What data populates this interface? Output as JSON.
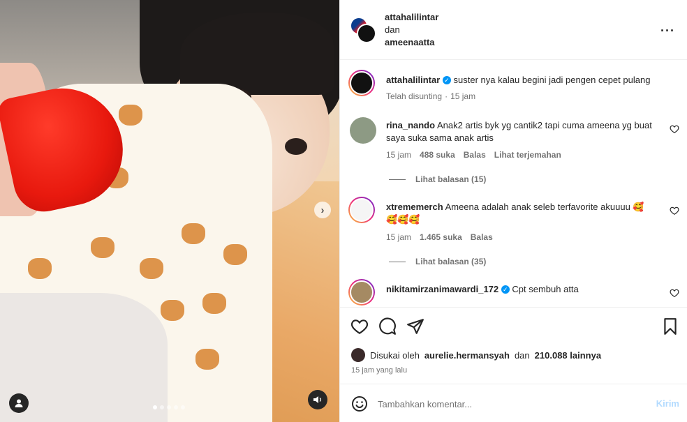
{
  "post": {
    "carousel_dots": 5,
    "active_dot": 0
  },
  "header": {
    "author": "attahalilintar",
    "joiner": "dan",
    "coauthor": "ameenaatta"
  },
  "caption": {
    "username": "attahalilintar",
    "text": "suster nya kalau begini jadi pengen cepet pulang",
    "edited": "Telah disunting",
    "separator": "·",
    "time": "15 jam"
  },
  "comments": [
    {
      "username": "rina_nando",
      "text": "Anak2 artis byk yg cantik2 tapi cuma ameena yg buat saya suka sama anak artis",
      "time": "15 jam",
      "likes": "488 suka",
      "reply": "Balas",
      "translate": "Lihat terjemahan",
      "view_replies": "Lihat balasan (15)"
    },
    {
      "username": "xtrememerch",
      "text": "Ameena adalah anak seleb terfavorite akuuuu 🥰",
      "emoji_line": "🥰🥰🥰",
      "time": "15 jam",
      "likes": "1.465 suka",
      "reply": "Balas",
      "view_replies": "Lihat balasan (35)"
    },
    {
      "username": "nikitamirzanimawardi_172",
      "text": "Cpt sembuh atta"
    }
  ],
  "likes": {
    "prefix": "Disukai oleh",
    "user": "aurelie.hermansyah",
    "joiner": "dan",
    "count": "210.088 lainnya"
  },
  "timestamp": "15 jam yang lalu",
  "comment_box": {
    "placeholder": "Tambahkan komentar...",
    "post_label": "Kirim"
  },
  "colors": {
    "accent": "#0095f6",
    "muted": "#737373",
    "post_disabled": "#b3dbff"
  }
}
